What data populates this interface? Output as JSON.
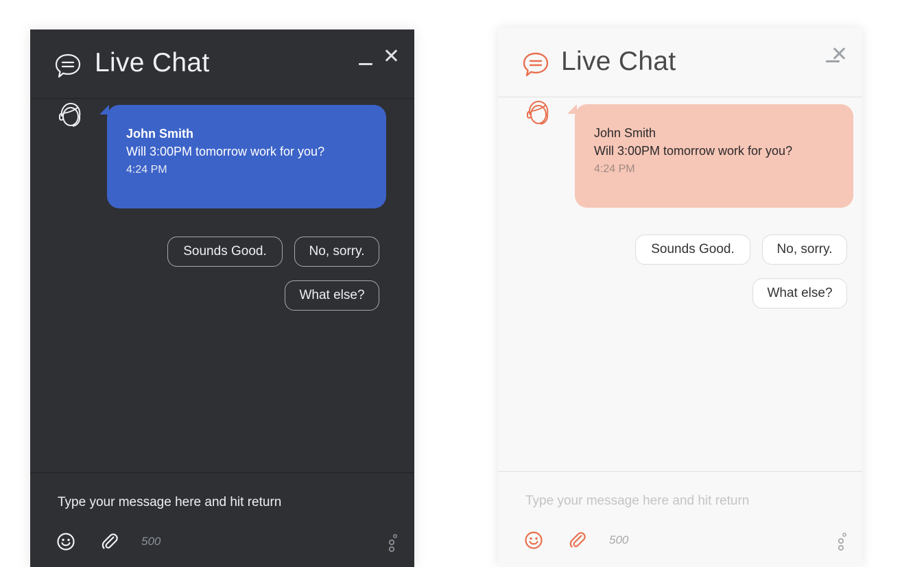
{
  "widgets": {
    "dark": {
      "theme": "dark",
      "accent_color": "#3c63c8",
      "background_color": "#2e3034",
      "header": {
        "icon": "chat-bubble-icon",
        "title": "Live Chat",
        "minimize_icon": "minimize-icon",
        "close_icon": "close-icon"
      },
      "message": {
        "avatar_icon": "agent-avatar-icon",
        "sender": "John Smith",
        "text": "Will 3:00PM tomorrow work for you?",
        "time": "4:24 PM"
      },
      "quick_replies": [
        "Sounds Good.",
        "No, sorry.",
        "What else?"
      ],
      "composer": {
        "placeholder": "Type your message here and hit return",
        "emoji_icon": "emoji-icon",
        "attach_icon": "paperclip-icon",
        "char_count": "500",
        "settings_icon": "settings-dots-icon"
      }
    },
    "light": {
      "theme": "light",
      "accent_color": "#e8704f",
      "bubble_color": "#f6c6b7",
      "background_color": "#f8f8f8",
      "header": {
        "icon": "chat-bubble-icon",
        "title": "Live Chat",
        "minimize_icon": "minimize-icon",
        "close_icon": "close-icon"
      },
      "message": {
        "avatar_icon": "agent-avatar-icon",
        "sender": "John Smith",
        "text": "Will 3:00PM tomorrow work for you?",
        "time": "4:24 PM"
      },
      "quick_replies": [
        "Sounds Good.",
        "No, sorry.",
        "What else?"
      ],
      "composer": {
        "placeholder": "Type your message here and hit return",
        "emoji_icon": "emoji-icon",
        "attach_icon": "paperclip-icon",
        "char_count": "500",
        "settings_icon": "settings-dots-icon"
      }
    }
  }
}
